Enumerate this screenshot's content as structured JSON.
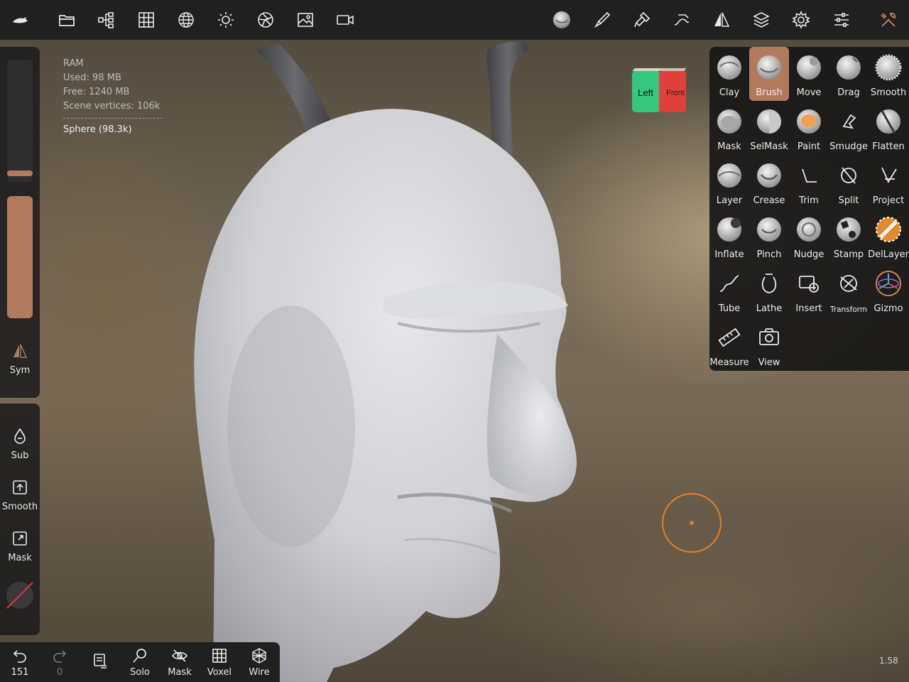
{
  "topbar": {
    "left_icons": [
      "app-logo-icon",
      "folder-icon",
      "scene-tree-icon",
      "grid-icon",
      "topology-icon",
      "light-icon",
      "material-icon",
      "image-icon",
      "video-icon"
    ],
    "right_icons": [
      "material-sphere-icon",
      "brush-stroke-icon",
      "painting-icon",
      "stroke-settings-icon",
      "symmetry-icon",
      "layers-icon",
      "settings-icon",
      "sliders-icon",
      "tools-icon"
    ],
    "accent": "#b27a5d"
  },
  "info": {
    "ram": "RAM",
    "used": "Used: 98 MB",
    "free": "Free: 1240 MB",
    "vertices": "Scene vertices: 106k",
    "object": "Sphere (98.3k)"
  },
  "view_cube": {
    "left": "Left",
    "front": "Front",
    "left_color": "#36c77f",
    "front_color": "#e2403a"
  },
  "left_panel": {
    "radius_level": 0.05,
    "intensity_level": 1.0,
    "sym_label": "Sym",
    "sub_label": "Sub",
    "smooth_label": "Smooth",
    "mask_label": "Mask"
  },
  "bottom_bar": {
    "undo_count": "151",
    "redo_count": "0",
    "solo_label": "Solo",
    "mask_label": "Mask",
    "voxel_label": "Voxel",
    "wire_label": "Wire"
  },
  "tools": {
    "active": "Brush",
    "rows": [
      [
        "Clay",
        "Brush",
        "Move",
        "Drag",
        "Smooth"
      ],
      [
        "Mask",
        "SelMask",
        "Paint",
        "Smudge",
        "Flatten"
      ],
      [
        "Layer",
        "Crease",
        "Trim",
        "Split",
        "Project"
      ],
      [
        "Inflate",
        "Pinch",
        "Nudge",
        "Stamp",
        "DelLayer"
      ],
      [
        "Tube",
        "Lathe",
        "Insert",
        "Transform",
        "Gizmo"
      ],
      [
        "Measure",
        "View"
      ]
    ]
  },
  "version": "1.58"
}
